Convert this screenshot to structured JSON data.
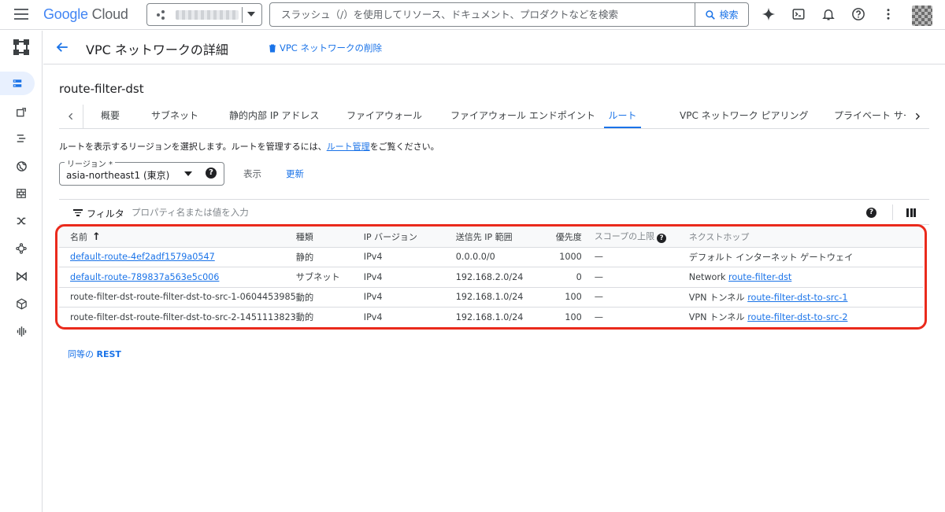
{
  "app": {
    "logo_google": "Google",
    "logo_cloud": "Cloud",
    "search_placeholder": "スラッシュ（/）を使用してリソース、ドキュメント、プロダクトなどを検索",
    "search_button": "検索"
  },
  "header": {
    "title": "VPC ネットワークの詳細",
    "delete_label": "VPC ネットワークの削除"
  },
  "network": {
    "name": "route-filter-dst"
  },
  "tabs": [
    {
      "label": "概要"
    },
    {
      "label": "サブネット"
    },
    {
      "label": "静的内部 IP アドレス"
    },
    {
      "label": "ファイアウォール"
    },
    {
      "label": "ファイアウォール エンドポイント"
    },
    {
      "label": "ルート"
    },
    {
      "label": "VPC ネットワーク ピアリング"
    },
    {
      "label": "プライベート サービス接続"
    }
  ],
  "info": {
    "text_before": "ルートを表示するリージョンを選択します。ルートを管理するには、",
    "link": "ルート管理",
    "text_after": "をご覧ください。"
  },
  "region": {
    "label": "リージョン *",
    "value": "asia-northeast1 (東京)",
    "show_label": "表示",
    "refresh_label": "更新"
  },
  "filter": {
    "label": "フィルタ",
    "placeholder": "プロパティ名または値を入力"
  },
  "table": {
    "columns": {
      "name": "名前",
      "type": "種類",
      "ip_version": "IP バージョン",
      "dest": "送信先 IP 範囲",
      "priority": "優先度",
      "scope": "スコープの上限",
      "next_hop": "ネクストホップ"
    },
    "rows": [
      {
        "name": "default-route-4ef2adf1579a0547",
        "type": "静的",
        "ip_version": "IPv4",
        "dest": "0.0.0.0/0",
        "priority": "1000",
        "scope": "—",
        "hop_prefix": "デフォルト インターネット ゲートウェイ",
        "hop_link": ""
      },
      {
        "name": "default-route-789837a563e5c006",
        "type": "サブネット",
        "ip_version": "IPv4",
        "dest": "192.168.2.0/24",
        "priority": "0",
        "scope": "—",
        "hop_prefix": "Network",
        "hop_link": "route-filter-dst"
      },
      {
        "name": "route-filter-dst-route-filter-dst-to-src-1-0604453985",
        "type": "動的",
        "ip_version": "IPv4",
        "dest": "192.168.1.0/24",
        "priority": "100",
        "scope": "—",
        "hop_prefix": "VPN トンネル",
        "hop_link": "route-filter-dst-to-src-1"
      },
      {
        "name": "route-filter-dst-route-filter-dst-to-src-2-1451113823",
        "type": "動的",
        "ip_version": "IPv4",
        "dest": "192.168.1.0/24",
        "priority": "100",
        "scope": "—",
        "hop_prefix": "VPN トンネル",
        "hop_link": "route-filter-dst-to-src-2"
      }
    ]
  },
  "rest": {
    "prefix": "同等の",
    "bold": "REST"
  },
  "colors": {
    "accent": "#1a73e8",
    "highlight": "#ea2a1c"
  }
}
